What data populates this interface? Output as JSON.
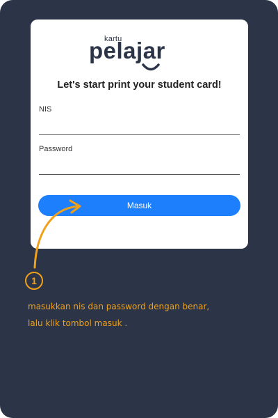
{
  "app": {
    "logo_small": "kartu",
    "logo_main": "pelajar"
  },
  "form": {
    "heading": "Let's start print your student card!",
    "nis_label": "NIS",
    "nis_value": "",
    "password_label": "Password",
    "password_value": "",
    "submit_label": "Masuk"
  },
  "tutorial": {
    "step_number": "1",
    "line1": "masukkan nis dan password dengan benar,",
    "line2": "lalu klik tombol masuk ."
  },
  "colors": {
    "frame": "#2c3547",
    "accent_button": "#1e7ffd",
    "annotation": "#f0a019"
  }
}
